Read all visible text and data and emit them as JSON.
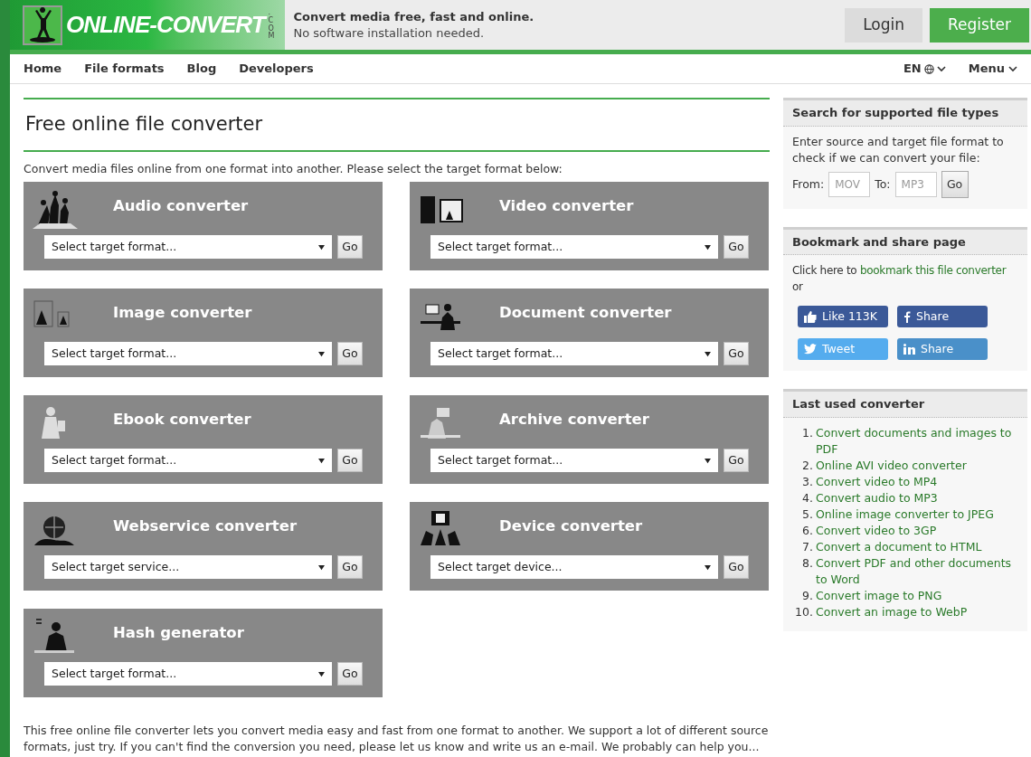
{
  "header": {
    "logo": "ONLINE-CONVERT",
    "logo_suffix": ".COM",
    "tagline": "Convert media free, fast and online.",
    "subtagline": "No software installation needed.",
    "buttons": [
      {
        "label": "Login",
        "kind": "login"
      },
      {
        "label": "Register",
        "kind": "register"
      }
    ]
  },
  "nav": {
    "items": [
      "Home",
      "File formats",
      "Blog",
      "Developers"
    ],
    "language": "EN",
    "menu": "Menu"
  },
  "main": {
    "title": "Free online file converter",
    "intro": "Convert media files online from one format into another. Please select the target format below:",
    "converters": [
      {
        "title": "Audio converter",
        "kind": "audio",
        "select": "Select target format...",
        "button": "Go"
      },
      {
        "title": "Video converter",
        "kind": "video",
        "select": "Select target format...",
        "button": "Go"
      },
      {
        "title": "Image converter",
        "kind": "image",
        "select": "Select target format...",
        "button": "Go"
      },
      {
        "title": "Document converter",
        "kind": "document",
        "select": "Select target format...",
        "button": "Go"
      },
      {
        "title": "Ebook converter",
        "kind": "ebook",
        "select": "Select target format...",
        "button": "Go"
      },
      {
        "title": "Archive converter",
        "kind": "archive",
        "select": "Select target format...",
        "button": "Go"
      },
      {
        "title": "Webservice converter",
        "kind": "webservice",
        "select": "Select target service...",
        "button": "Go"
      },
      {
        "title": "Device converter",
        "kind": "device",
        "select": "Select target device...",
        "button": "Go"
      },
      {
        "title": "Hash generator",
        "kind": "hash",
        "select": "Select target format...",
        "button": "Go"
      }
    ],
    "footer_text": "This free online file converter lets you convert media easy and fast from one format to another. We support a lot of different source formats, just try. If you can't find the conversion you need, please let us know and write us an e-mail. We probably can help you..."
  },
  "sidebar": {
    "search": {
      "title": "Search for supported file types",
      "text": "Enter source and target file format to check if we can convert your file:",
      "from_label": "From:",
      "from_placeholder": "MOV",
      "to_label": "To:",
      "to_placeholder": "MP3",
      "button": "Go"
    },
    "bookmark": {
      "title": "Bookmark and share page",
      "text": "Click here to",
      "link": "bookmark this file converter",
      "text_after": "or",
      "social": [
        {
          "label": "Like 113K",
          "kind": "like",
          "color": "#3b5998"
        },
        {
          "label": "Share",
          "kind": "facebook",
          "color": "#3b5998"
        },
        {
          "label": "Tweet",
          "kind": "twitter",
          "color": "#55acee"
        },
        {
          "label": "Share",
          "kind": "linkedin",
          "color": "#4a90c9"
        }
      ]
    },
    "last_used": {
      "title": "Last used converter",
      "items": [
        {
          "number": "1.",
          "label": "Convert documents and images to PDF"
        },
        {
          "number": "2.",
          "label": "Online AVI video converter"
        },
        {
          "number": "3.",
          "label": "Convert video to MP4"
        },
        {
          "number": "4.",
          "label": "Convert audio to MP3"
        },
        {
          "number": "5.",
          "label": "Online image converter to JPEG"
        },
        {
          "number": "6.",
          "label": "Convert video to 3GP"
        },
        {
          "number": "7.",
          "label": "Convert a document to HTML"
        },
        {
          "number": "8.",
          "label": "Convert PDF and other documents to Word"
        },
        {
          "number": "9.",
          "label": "Convert image to PNG"
        },
        {
          "number": "10.",
          "label": "Convert an image to WebP"
        }
      ]
    }
  }
}
